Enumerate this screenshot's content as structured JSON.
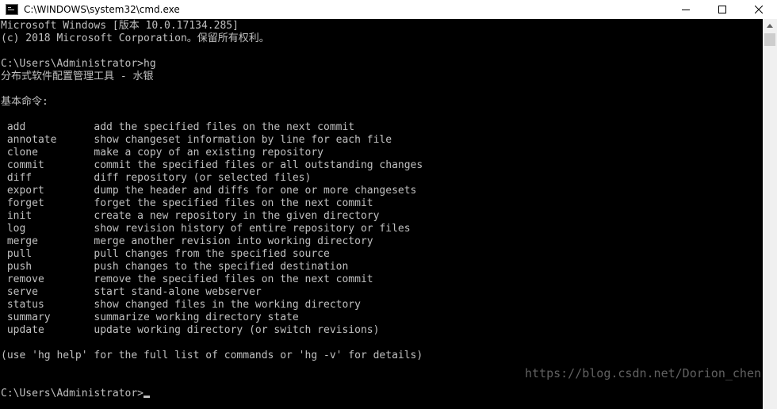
{
  "window": {
    "title": "C:\\WINDOWS\\system32\\cmd.exe",
    "controls": {
      "minimize_icon": "minimize-icon",
      "maximize_icon": "maximize-icon",
      "close_icon": "close-icon"
    }
  },
  "console": {
    "lines": [
      "Microsoft Windows [版本 10.0.17134.285]",
      "(c) 2018 Microsoft Corporation。保留所有权利。",
      "",
      "C:\\Users\\Administrator>hg",
      "分布式软件配置管理工具 - 水银",
      "",
      "基本命令:",
      "",
      " add           add the specified files on the next commit",
      " annotate      show changeset information by line for each file",
      " clone         make a copy of an existing repository",
      " commit        commit the specified files or all outstanding changes",
      " diff          diff repository (or selected files)",
      " export        dump the header and diffs for one or more changesets",
      " forget        forget the specified files on the next commit",
      " init          create a new repository in the given directory",
      " log           show revision history of entire repository or files",
      " merge         merge another revision into working directory",
      " pull          pull changes from the specified source",
      " push          push changes to the specified destination",
      " remove        remove the specified files on the next commit",
      " serve         start stand-alone webserver",
      " status        show changed files in the working directory",
      " summary       summarize working directory state",
      " update        update working directory (or switch revisions)",
      "",
      "(use 'hg help' for the full list of commands or 'hg -v' for details)",
      "",
      ""
    ],
    "prompt": "C:\\Users\\Administrator>"
  },
  "watermark": "https://blog.csdn.net/Dorion_chen",
  "colors": {
    "console_bg": "#000000",
    "console_fg": "#c0c0c0",
    "titlebar_bg": "#ffffff",
    "scrollbar_bg": "#f0f0f0"
  }
}
